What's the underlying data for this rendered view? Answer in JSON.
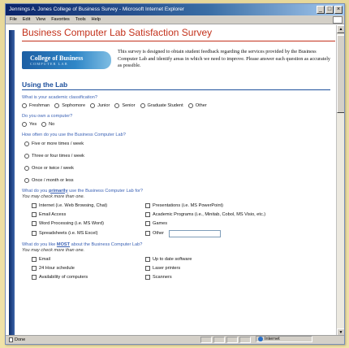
{
  "window": {
    "title": "Jennings A. Jones College of Business Survey - Microsoft Internet Explorer",
    "controls": {
      "minimize": "_",
      "maximize": "□",
      "close": "×"
    }
  },
  "menubar": [
    "File",
    "Edit",
    "View",
    "Favorites",
    "Tools",
    "Help"
  ],
  "page": {
    "title": "Business Computer Lab Satisfaction Survey",
    "logo": {
      "line1": "College of Business",
      "line2": "COMPUTER LAB"
    },
    "intro": "This survey is designed to obtain student feedback regarding the services provided by the Business Computer Lab and identify areas in which we need to improve. Please answer each question as accurately as possible.",
    "section_heading": "Using the Lab",
    "q1": {
      "text": "What is your academic classification?",
      "options": [
        "Freshman",
        "Sophomore",
        "Junior",
        "Senior",
        "Graduate Student",
        "Other"
      ]
    },
    "q2": {
      "text": "Do you own a computer?",
      "options": [
        "Yes",
        "No"
      ]
    },
    "q3": {
      "text": "How often do you use the Business Computer Lab?",
      "options": [
        "Five or more times / week",
        "Three or four times / week",
        "Once or twice / week",
        "Once / month or less"
      ]
    },
    "q4": {
      "text_before": "What do you",
      "text_emph": "primarily",
      "text_after": "use the Business Computer Lab for?",
      "hint": "You may check more than one.",
      "left": [
        "Internet (i.e. Web Browsing, Chat)",
        "Email Access",
        "Word Processing (i.e. MS Word)",
        "Spreadsheets (i.e. MS Excel)"
      ],
      "right": [
        "Presentations (i.e. MS PowerPoint)",
        "Academic Programs (i.e., Minitab, Cobol, MS Visio, etc.)",
        "Games",
        "Other"
      ]
    },
    "q5": {
      "text_before": "What do you like",
      "text_emph": "MOST",
      "text_after": "about the Business Computer Lab?",
      "hint": "You may check more than one.",
      "left": [
        "Email",
        "24 Hour schedule",
        "Availability of computers"
      ],
      "right": [
        "Up to date software",
        "Laser printers",
        "Scanners"
      ]
    }
  },
  "statusbar": {
    "left": "Done",
    "zone": "Internet"
  }
}
